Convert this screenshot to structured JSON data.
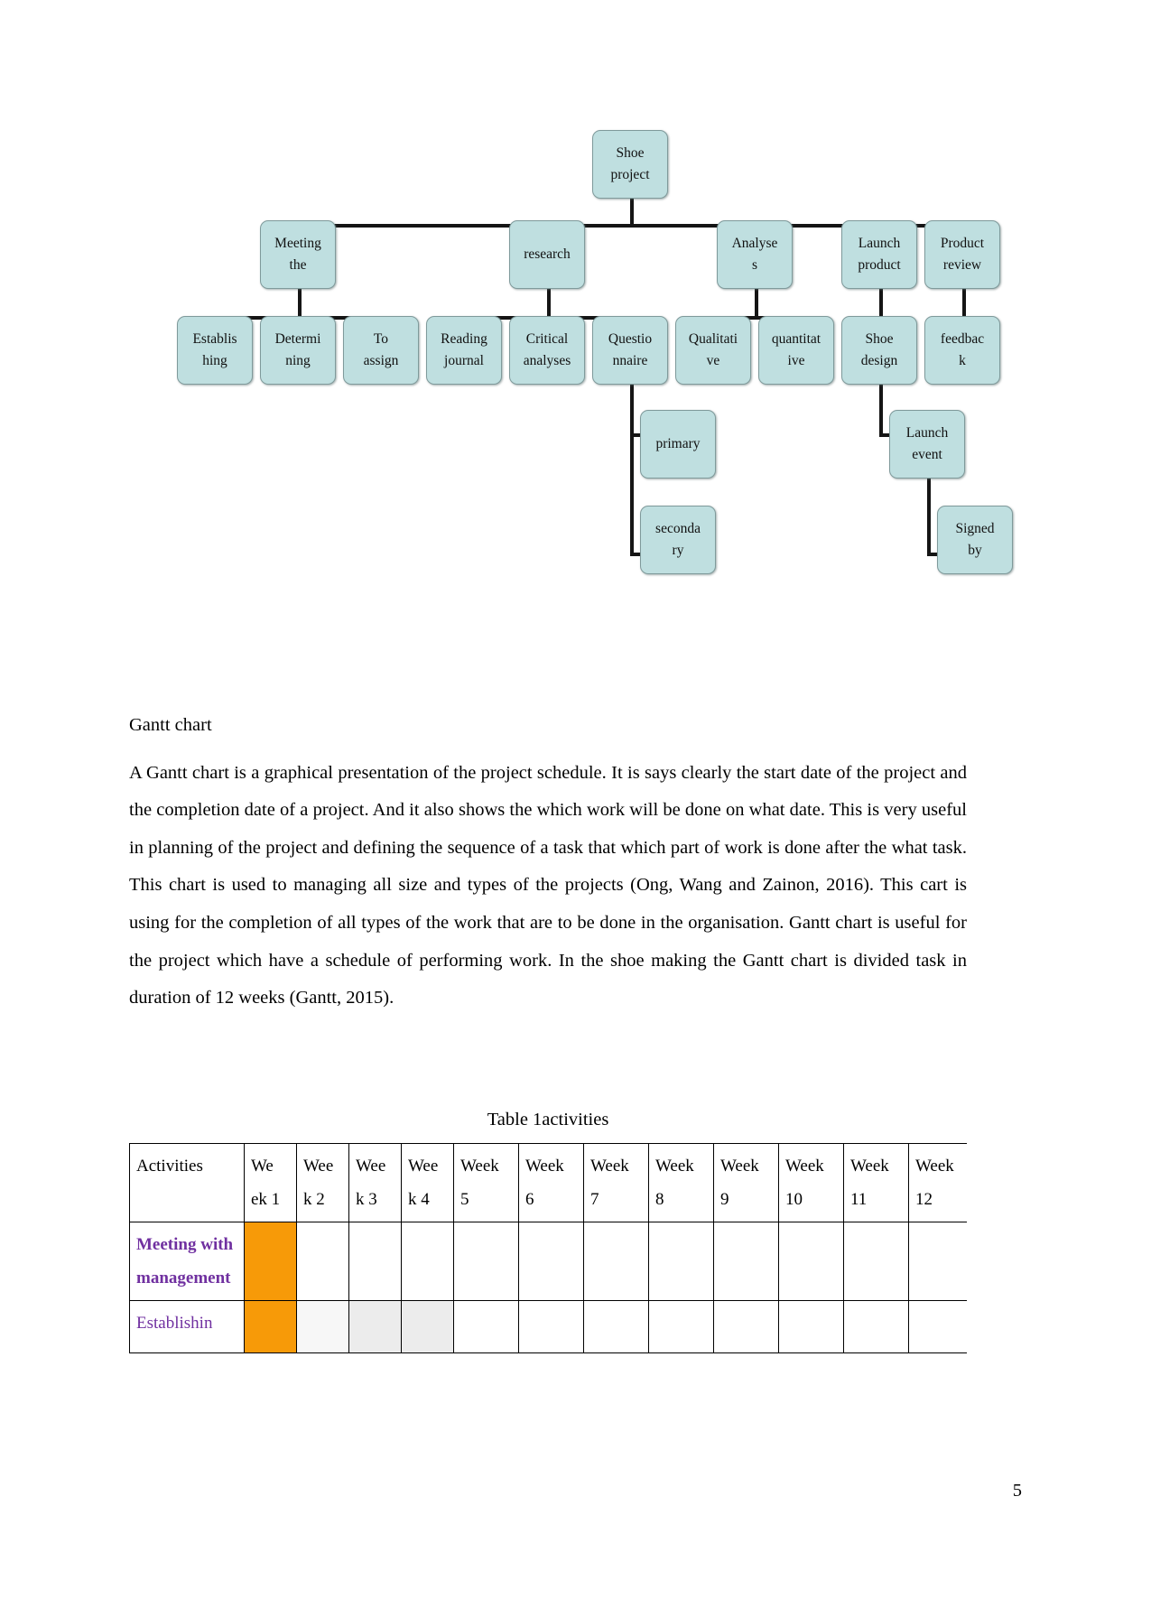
{
  "document": {
    "page_number": "5",
    "heading": "Gantt chart",
    "paragraph": "A Gantt chart is a graphical presentation of the project schedule. It is says clearly the start date of the project and the completion date of a project. And it also shows the which work will be done on what date. This is very useful in planning of the project and defining the sequence of a task that which part of work is done after the what task. This chart is used to managing all size and types of the projects (Ong, Wang and Zainon, 2016). This cart is using for the completion of all types of the work that are to be done in the organisation. Gantt chart is useful for the project which have a schedule of performing work. In the shoe making the Gantt chart is divided task in duration of 12 weeks (Gantt, 2015).",
    "table_caption": "Table 1activities"
  },
  "diagram": {
    "type": "work-breakdown-structure",
    "node_fill": "#bfdfe0",
    "node_border": "#7f9a9b",
    "edge_color": "#151515",
    "nodes": {
      "root": {
        "line1": "Shoe",
        "line2": "project"
      },
      "meeting": {
        "line1": "Meeting",
        "line2": "the"
      },
      "research": {
        "line1": "research",
        "line2": ""
      },
      "analyses": {
        "line1": "Analyse",
        "line2": "s"
      },
      "launch": {
        "line1": "Launch",
        "line2": "product"
      },
      "review": {
        "line1": "Product",
        "line2": "review"
      },
      "establishing": {
        "line1": "Establis",
        "line2": "hing"
      },
      "determining": {
        "line1": "Determi",
        "line2": "ning"
      },
      "toassign": {
        "line1": "To",
        "line2": "assign"
      },
      "reading": {
        "line1": "Reading",
        "line2": "journal"
      },
      "critical": {
        "line1": "Critical",
        "line2": "analyses"
      },
      "questionnaire": {
        "line1": "Questio",
        "line2": "nnaire"
      },
      "qualitative": {
        "line1": "Qualitati",
        "line2": "ve"
      },
      "quantitative": {
        "line1": "quantitat",
        "line2": "ive"
      },
      "shoedesign": {
        "line1": "Shoe",
        "line2": "design"
      },
      "feedback": {
        "line1": "feedbac",
        "line2": "k"
      },
      "primary": {
        "line1": "primary",
        "line2": ""
      },
      "secondary": {
        "line1": "seconda",
        "line2": "ry"
      },
      "launchevent": {
        "line1": "Launch",
        "line2": "event"
      },
      "signedby": {
        "line1": "Signed",
        "line2": "by"
      }
    }
  },
  "chart_data": {
    "type": "table",
    "title": "Table 1activities",
    "columns": [
      {
        "key": "activities",
        "line1": "Activities",
        "line2": ""
      },
      {
        "key": "w1",
        "line1": "We",
        "line2": "ek 1"
      },
      {
        "key": "w2",
        "line1": "Wee",
        "line2": "k 2"
      },
      {
        "key": "w3",
        "line1": "Wee",
        "line2": "k 3"
      },
      {
        "key": "w4",
        "line1": "Wee",
        "line2": "k 4"
      },
      {
        "key": "w5",
        "line1": "Week",
        "line2": "5"
      },
      {
        "key": "w6",
        "line1": "Week",
        "line2": "6"
      },
      {
        "key": "w7",
        "line1": "Week",
        "line2": "7"
      },
      {
        "key": "w8",
        "line1": "Week",
        "line2": "8"
      },
      {
        "key": "w9",
        "line1": "Week",
        "line2": "9"
      },
      {
        "key": "w10",
        "line1": "Week",
        "line2": "10"
      },
      {
        "key": "w11",
        "line1": "Week",
        "line2": "11"
      },
      {
        "key": "w12",
        "line1": "Week",
        "line2": "12"
      }
    ],
    "rows": [
      {
        "label": "Meeting with management",
        "label_bold": true,
        "label_color": "#7030a0",
        "cells": [
          "orange",
          "none",
          "none",
          "none",
          "none",
          "none",
          "none",
          "none",
          "none",
          "none",
          "none",
          "none"
        ]
      },
      {
        "label": "Establishin",
        "label_bold": false,
        "label_color": "#7030a0",
        "cells": [
          "orange",
          "light",
          "gray",
          "gray",
          "none",
          "none",
          "none",
          "none",
          "none",
          "none",
          "none",
          "none"
        ]
      }
    ],
    "fill_colors": {
      "orange": "#f79a08",
      "gray": "#ececec",
      "light": "#f7f7f7",
      "none": "transparent"
    }
  }
}
